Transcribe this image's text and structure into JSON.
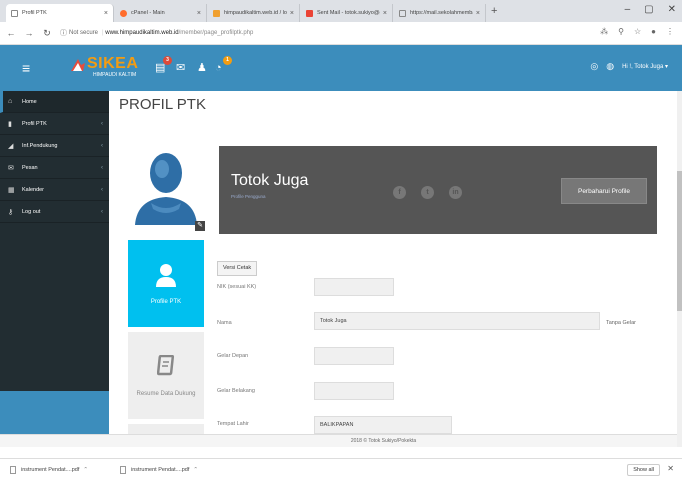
{
  "browser": {
    "tabs": [
      {
        "title": "Profil PTK",
        "icon": "page-icon",
        "active": true
      },
      {
        "title": "cPanel - Main",
        "icon": "cpanel-icon",
        "active": false
      },
      {
        "title": "himpaudikaltim.web.id / local /",
        "icon": "phpmyadmin-icon",
        "active": false
      },
      {
        "title": "Sent Mail - totok.sukiyo@go",
        "icon": "gmail-icon",
        "active": false
      },
      {
        "title": "https://mail.sekolahmembangun",
        "icon": "page-icon",
        "active": false
      }
    ],
    "security_label": "Not secure",
    "url_domain": "www.himpaudikaltim.web.id",
    "url_path": "/member/page_profilptk.php"
  },
  "header": {
    "logo_text": "SIKEA",
    "logo_subtext": "HIMPAUDI KALTIM",
    "badges": [
      "3",
      "",
      "",
      "1"
    ],
    "user_greeting": "Hi !, Totok Juga"
  },
  "sidebar": {
    "items": [
      {
        "label": "Home",
        "icon": "home-icon"
      },
      {
        "label": "Profil PTK",
        "icon": "book-icon"
      },
      {
        "label": "Inf.Pendukung",
        "icon": "chart-icon"
      },
      {
        "label": "Pesan",
        "icon": "envelope-icon"
      },
      {
        "label": "Kalender",
        "icon": "calendar-icon"
      },
      {
        "label": "Log out",
        "icon": "key-icon"
      }
    ]
  },
  "main": {
    "page_title": "PROFIL PTK",
    "profile": {
      "name": "Totok Juga",
      "role": "Profile Pengguna",
      "update_button": "Perbaharui Profile"
    },
    "tiles": [
      {
        "label": "Profile PTK"
      },
      {
        "label": "Resume Data Dukung"
      }
    ],
    "form": {
      "print_button": "Versi Cetak",
      "fields": [
        {
          "label": "NIK (sesuai KK)",
          "value": ""
        },
        {
          "label": "Nama",
          "value": "Totok Juga"
        },
        {
          "label": "Gelar Depan",
          "value": ""
        },
        {
          "label": "Gelar Belakang",
          "value": ""
        },
        {
          "label": "Tempat Lahir",
          "value": "BALIKPAPAN"
        }
      ],
      "no_title_label": "Tanpa Gelar"
    }
  },
  "footer": {
    "text": "2018 © Totok Sukiyo/Pokekta"
  },
  "downloads": {
    "items": [
      {
        "name": "instrument Pendat....pdf"
      },
      {
        "name": "instrument Pendat....pdf"
      }
    ],
    "show_all": "Show all"
  },
  "colors": {
    "header_blue": "#3c8dbc",
    "sidebar_dark": "#222d32",
    "logo_orange": "#f39c12",
    "tile_cyan": "#00c0ef",
    "banner_gray": "#555555"
  }
}
